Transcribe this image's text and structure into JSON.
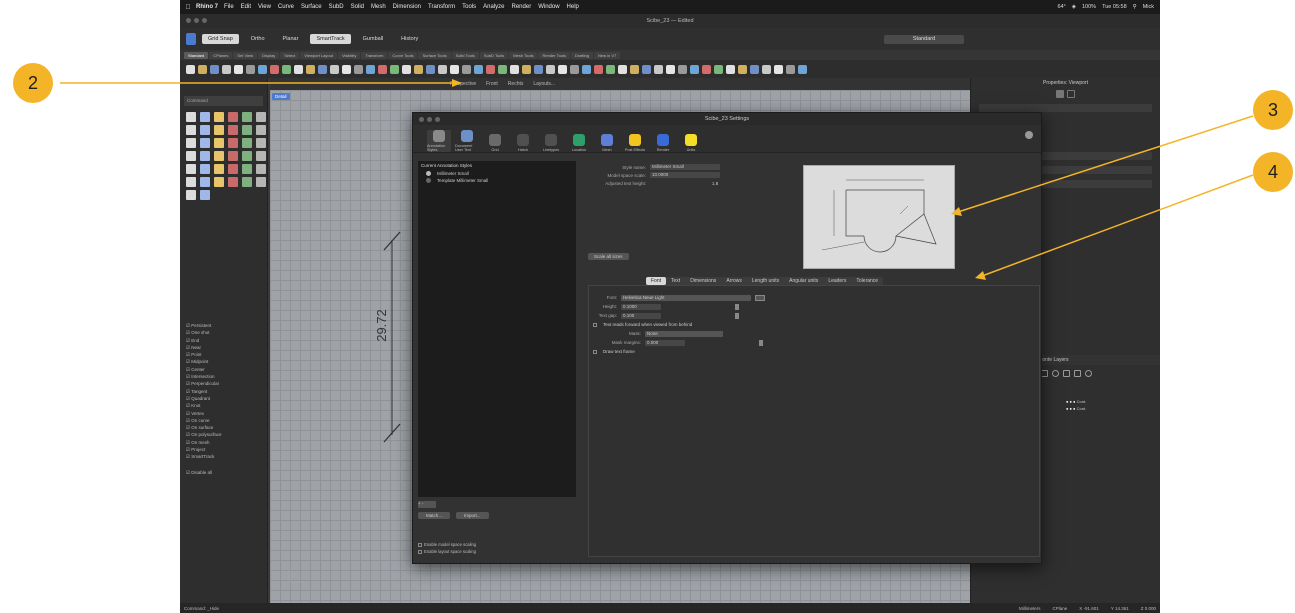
{
  "menubar": {
    "app_name": "Rhino 7",
    "items": [
      "File",
      "Edit",
      "View",
      "Curve",
      "Surface",
      "SubD",
      "Solid",
      "Mesh",
      "Dimension",
      "Transform",
      "Tools",
      "Analyze",
      "Render",
      "Window",
      "Help"
    ],
    "temperature": "64°",
    "battery": "100%",
    "clock": "Tue 05:58",
    "user": "Mick"
  },
  "window": {
    "title": "Scibe_23 — Edited"
  },
  "toolbar": {
    "grid_snap": "Grid Snap",
    "ortho": "Ortho",
    "planar": "Planar",
    "smarttrack": "SmartTrack",
    "gumball": "Gumball",
    "history": "History",
    "display_mode": "Standard",
    "tabs": [
      "Standard",
      "CPlanes",
      "Set View",
      "Display",
      "Select",
      "Viewport Layout",
      "Visibility",
      "Transform",
      "Curve Tools",
      "Surface Tools",
      "Solid Tools",
      "SubD Tools",
      "Mesh Tools",
      "Render Tools",
      "Drafting",
      "New in V7"
    ]
  },
  "left_sidebar": {
    "command_placeholder": "Command",
    "osnaps": [
      "Persistent",
      "One shot",
      "End",
      "Near",
      "Point",
      "Midpoint",
      "Center",
      "Intersection",
      "Perpendicular",
      "Tangent",
      "Quadrant",
      "Knot",
      "Vertex",
      "On curve",
      "On surface",
      "On polysurface",
      "On mesh",
      "Project",
      "SmartTrack",
      "Disable all"
    ]
  },
  "viewport": {
    "label": "Detail",
    "tabs": [
      "Perspective",
      "Front",
      "Rechts",
      "Layouts..."
    ],
    "dimension_value": "29.72"
  },
  "right_panel": {
    "header": "Properties: Viewport",
    "layers_header": "Ponte Layers",
    "layer_rows": [
      "Cont.",
      "Cont."
    ]
  },
  "statusbar": {
    "command_label": "Command: _Hide",
    "units": "Millimeters",
    "cplane": "CPlane",
    "x": "X -91.601",
    "y": "Y 14.361",
    "z": "Z 0.000"
  },
  "dialog": {
    "title": "Scibe_23 Settings",
    "categories": [
      {
        "label": "Annotation Styles",
        "icon": "annotation-styles-icon",
        "color": "#8a8a8a"
      },
      {
        "label": "Document User Text",
        "icon": "document-user-text-icon",
        "color": "#6f8fc7"
      },
      {
        "label": "Grid",
        "icon": "grid-icon",
        "color": "#6a6a6a"
      },
      {
        "label": "Hatch",
        "icon": "hatch-icon",
        "color": "#505050"
      },
      {
        "label": "Linetypes",
        "icon": "linetypes-icon",
        "color": "#505050"
      },
      {
        "label": "Location",
        "icon": "location-icon",
        "color": "#2e9e6b"
      },
      {
        "label": "Mesh",
        "icon": "mesh-icon",
        "color": "#5e7fd6"
      },
      {
        "label": "Post Effects",
        "icon": "post-effects-icon",
        "color": "#f3c321"
      },
      {
        "label": "Render",
        "icon": "render-icon",
        "color": "#3a6ad6"
      },
      {
        "label": "Units",
        "icon": "units-icon",
        "color": "#f3df28"
      }
    ],
    "styles_header": "Current  Annotation Styles",
    "styles": [
      "Millimeter Small",
      "Template Millimeter Small"
    ],
    "add_remove": "+ -",
    "match_button": "Match...",
    "import_button": "Import...",
    "enable_model_space_scaling": "Enable model space scaling",
    "enable_layout_space_scaling": "Enable layout space scaling",
    "style_name_label": "Style name:",
    "style_name_value": "Millimeter Small",
    "model_space_scale_label": "Model space scale:",
    "model_space_scale_value": "10.0000",
    "adjusted_text_height_label": "Adjusted text height:",
    "adjusted_text_height_value": "1.8",
    "scale_all_button": "Scale all sizes",
    "subtabs": [
      "Font",
      "Text",
      "Dimensions",
      "Arrows",
      "Length units",
      "Angular units",
      "Leaders",
      "Tolerance"
    ],
    "font_label": "Font:",
    "font_value": "Helvetica Neue Light",
    "height_label": "Height:",
    "height_value": "0.1000",
    "text_gap_label": "Text gap:",
    "text_gap_value": "0.100",
    "text_reads_forward": "Text reads forward when viewed from behind",
    "mask_label": "Mask:",
    "mask_value": "None",
    "mask_margins_label": "Mask margins:",
    "mask_margins_value": "0.000",
    "draw_text_frame": "Draw text frame"
  },
  "callouts": [
    {
      "number": "2",
      "color": "#f3b427"
    },
    {
      "number": "3",
      "color": "#f3b427"
    },
    {
      "number": "4",
      "color": "#f3b427"
    }
  ]
}
